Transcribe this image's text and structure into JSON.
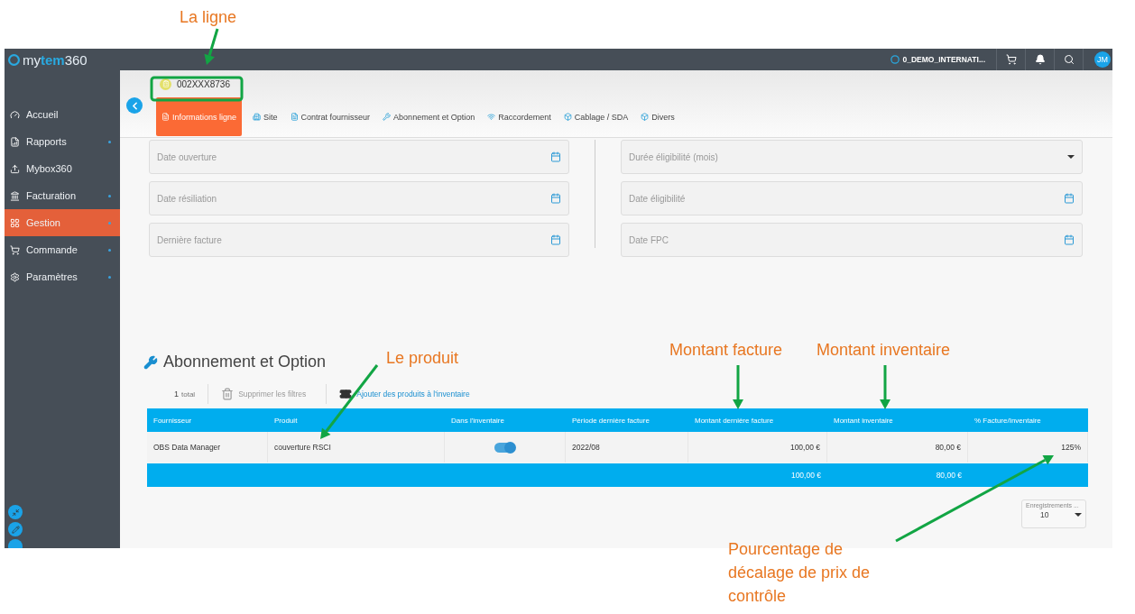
{
  "annotations": [
    {
      "text": "La ligne"
    },
    {
      "text": "Le produit"
    },
    {
      "text": "Montant facture"
    },
    {
      "text": "Montant inventaire"
    },
    {
      "text": "Pourcentage de décalage de prix de contrôle"
    }
  ],
  "topbar": {
    "logo": "my**tem**360",
    "organization": "0_DEMO_INTERNATI...",
    "avatar": "JM"
  },
  "sidebar": {
    "items": [
      {
        "label": "Accueil",
        "has_submenu": false,
        "selected": false
      },
      {
        "label": "Rapports",
        "has_submenu": true,
        "selected": false
      },
      {
        "label": "Mybox360",
        "has_submenu": false,
        "selected": false
      },
      {
        "label": "Facturation",
        "has_submenu": true,
        "selected": false
      },
      {
        "label": "Gestion",
        "has_submenu": true,
        "selected": true
      },
      {
        "label": "Commande",
        "has_submenu": true,
        "selected": false
      },
      {
        "label": "Paramètres",
        "has_submenu": true,
        "selected": false
      }
    ]
  },
  "header": {
    "line_id": "002XXX8736",
    "tabs": [
      {
        "label": "Informations ligne",
        "selected": true
      },
      {
        "label": "Site",
        "selected": false
      },
      {
        "label": "Contrat fournisseur",
        "selected": false
      },
      {
        "label": "Abonnement et Option",
        "selected": false
      },
      {
        "label": "Raccordement",
        "selected": false
      },
      {
        "label": "Cablage / SDA",
        "selected": false
      },
      {
        "label": "Divers",
        "selected": false
      }
    ]
  },
  "form": {
    "left": [
      {
        "placeholder": "Date ouverture",
        "kind": "date"
      },
      {
        "placeholder": "Date résiliation",
        "kind": "date"
      },
      {
        "placeholder": "Dernière facture",
        "kind": "date"
      }
    ],
    "right": [
      {
        "placeholder": "Durée éligibilité (mois)",
        "kind": "select"
      },
      {
        "placeholder": "Date éligibilité",
        "kind": "date"
      },
      {
        "placeholder": "Date FPC",
        "kind": "date"
      }
    ]
  },
  "section": {
    "title": "Abonnement et Option",
    "count": "1",
    "count_label": "total",
    "clear_filters": {
      "label": "Supprimer les filtres",
      "disabled": true
    },
    "add_products": "Ajouter des produits à l'inventaire"
  },
  "table": {
    "columns": [
      "Fournisseur",
      "Produit",
      "Dans l'inventaire",
      "Période dernière facture",
      "Montant dernière facture",
      "Montant inventaire",
      "% Facture/Inventaire"
    ],
    "rows": [
      {
        "supplier": "OBS Data Manager",
        "product": "couverture RSCI",
        "in_inventory": true,
        "period": "2022/08",
        "invoice_amount": "100,00 €",
        "inventory_amount": "80,00 €",
        "ratio": "125%"
      }
    ],
    "totals": {
      "invoice_amount": "100,00 €",
      "inventory_amount": "80,00 €"
    }
  },
  "page_size": {
    "label": "Enregistrements ...",
    "value": "10"
  }
}
